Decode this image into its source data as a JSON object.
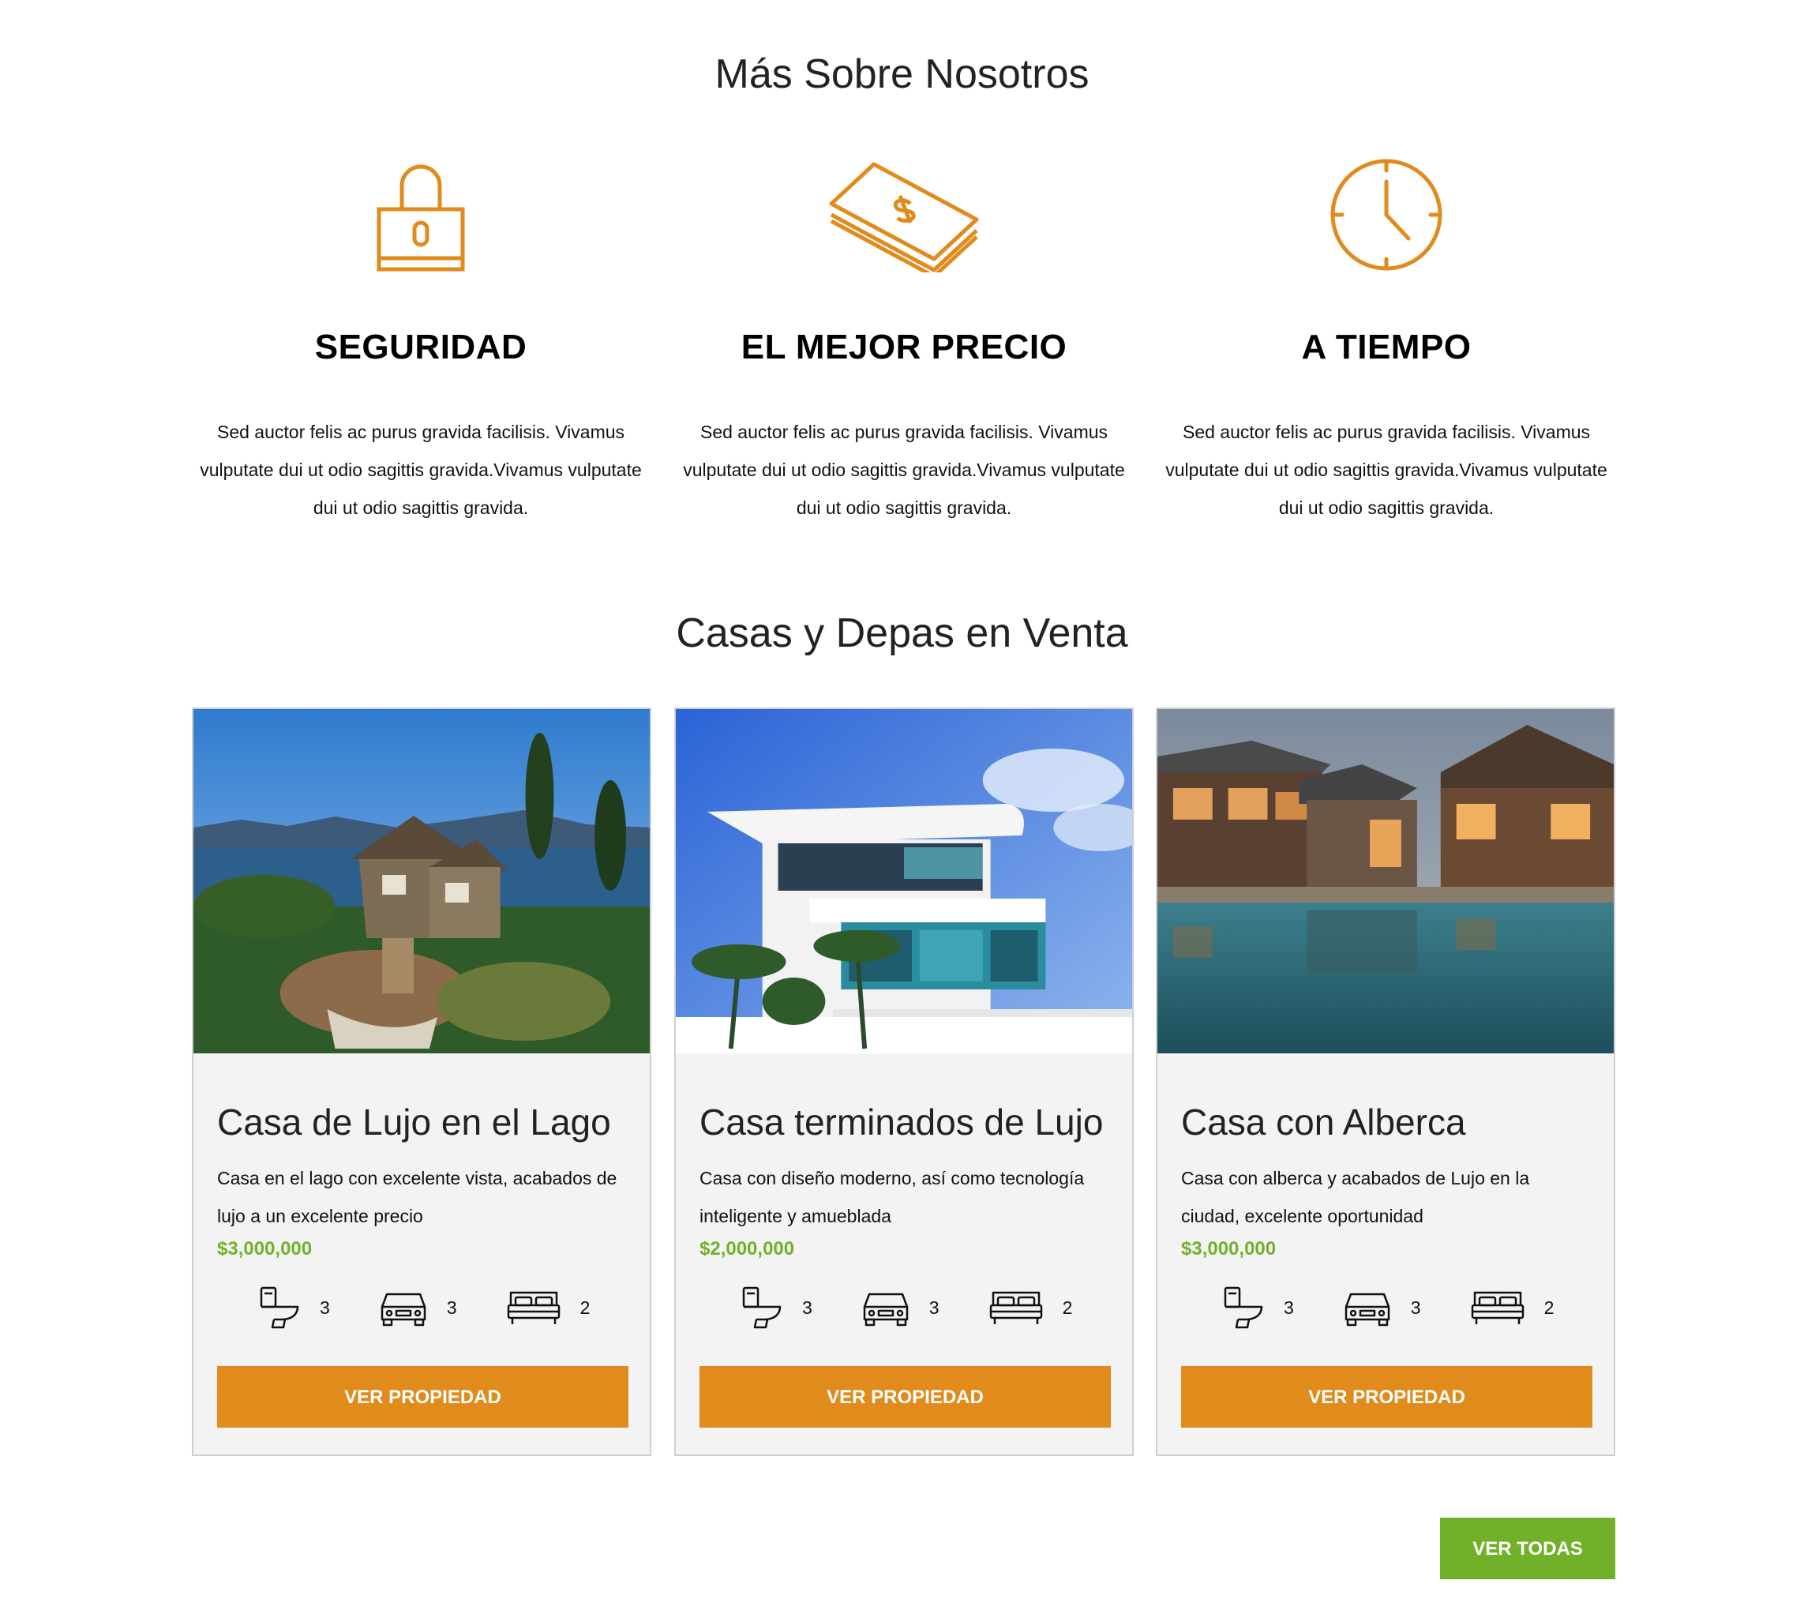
{
  "about": {
    "title": "Más Sobre Nosotros",
    "features": [
      {
        "icon": "lock-icon",
        "title": "SEGURIDAD",
        "text": "Sed auctor felis ac purus gravida facilisis. Vivamus vulputate dui ut odio sagittis gravida.Vivamus vulputate dui ut odio sagittis gravida."
      },
      {
        "icon": "money-icon",
        "title": "EL MEJOR PRECIO",
        "text": "Sed auctor felis ac purus gravida facilisis. Vivamus vulputate dui ut odio sagittis gravida.Vivamus vulputate dui ut odio sagittis gravida."
      },
      {
        "icon": "clock-icon",
        "title": "A TIEMPO",
        "text": "Sed auctor felis ac purus gravida facilisis. Vivamus vulputate dui ut odio sagittis gravida.Vivamus vulputate dui ut odio sagittis gravida."
      }
    ]
  },
  "listings": {
    "title": "Casas y Depas en Venta",
    "cards": [
      {
        "title": "Casa de Lujo en el Lago",
        "description": "Casa en el lago con excelente vista, acabados de lujo a un excelente precio",
        "price": "$3,000,000",
        "baths": "3",
        "parking": "3",
        "bedrooms": "2",
        "button": "VER PROPIEDAD"
      },
      {
        "title": "Casa terminados de Lujo",
        "description": "Casa con diseño moderno, así como tecnología inteligente y amueblada",
        "price": "$2,000,000",
        "baths": "3",
        "parking": "3",
        "bedrooms": "2",
        "button": "VER PROPIEDAD"
      },
      {
        "title": "Casa con Alberca",
        "description": "Casa con alberca y acabados de Lujo en la ciudad, excelente oportunidad",
        "price": "$3,000,000",
        "baths": "3",
        "parking": "3",
        "bedrooms": "2",
        "button": "VER PROPIEDAD"
      }
    ],
    "view_all": "VER TODAS"
  },
  "colors": {
    "accent": "#e08b1b",
    "green": "#71b12a",
    "card_bg": "#f3f3f3"
  }
}
